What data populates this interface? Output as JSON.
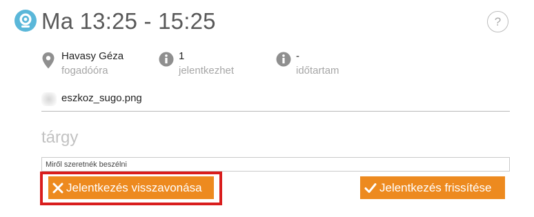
{
  "header": {
    "title": "Ma 13:25 - 15:25",
    "help_label": "?",
    "icon": "webcam-icon",
    "icon_color": "#5ab7d9"
  },
  "info": [
    {
      "icon": "location-pin-icon",
      "value": "Havasy Géza",
      "label": "fogadóóra"
    },
    {
      "icon": "info-icon",
      "value": "1",
      "label": "jelentkezhet"
    },
    {
      "icon": "info-icon",
      "value": "-",
      "label": "időtartam"
    }
  ],
  "attachment": {
    "icon": "image-thumbnail",
    "filename": "eszkoz_sugo.png"
  },
  "subject": {
    "label": "tárgy",
    "value": "",
    "placeholder": "Miről szeretnék beszélni"
  },
  "actions": {
    "cancel_label": "Jelentkezés visszavonása",
    "cancel_icon": "close-icon",
    "update_label": "Jelentkezés frissítése",
    "update_icon": "checkmark-icon",
    "button_color": "#ed8a1f",
    "highlight_color": "#d91d1d"
  }
}
